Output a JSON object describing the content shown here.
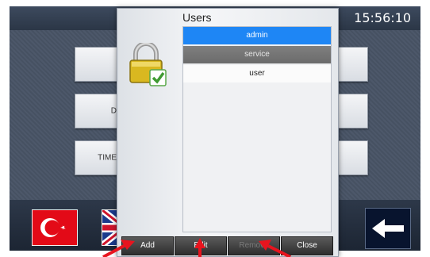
{
  "app": {
    "clock": "15:56:10"
  },
  "background": {
    "buttons": [
      {
        "label": ""
      },
      {
        "label": "D"
      },
      {
        "label": "TIME"
      },
      {
        "label": ""
      },
      {
        "label": ""
      },
      {
        "label": ""
      }
    ]
  },
  "dialog": {
    "title": "Users",
    "users": [
      {
        "name": "admin",
        "state": "selected"
      },
      {
        "name": "service",
        "state": "highlighted"
      },
      {
        "name": "user",
        "state": "normal"
      }
    ],
    "buttons": {
      "add": "Add",
      "edit": "Edit",
      "remove": "Remove",
      "close": "Close"
    }
  },
  "icons": {
    "lock": "lock-check-icon",
    "flag_tr": "turkey-flag-icon",
    "flag_uk": "uk-flag-icon",
    "back": "arrow-left-icon"
  },
  "colors": {
    "selection": "#1e86f5",
    "annotation_arrow": "#e8141e"
  }
}
